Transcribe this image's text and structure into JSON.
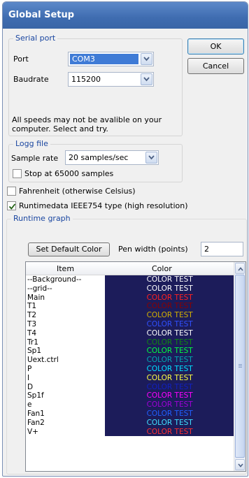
{
  "window": {
    "title": "Global Setup"
  },
  "serial_port": {
    "title": "Serial port",
    "port_label": "Port",
    "port_value": "COM3",
    "baudrate_label": "Baudrate",
    "baudrate_value": "115200",
    "note": "All speeds may not be avalible on your computer. Select and try."
  },
  "buttons": {
    "ok": "OK",
    "cancel": "Cancel"
  },
  "logg_file": {
    "title": "Logg file",
    "sample_rate_label": "Sample rate",
    "sample_rate_value": "20 samples/sec",
    "stop_label": "Stop at 65000 samples",
    "stop_checked": false
  },
  "options": {
    "fahrenheit_label": "Fahrenheit (otherwise Celsius)",
    "fahrenheit_checked": false,
    "runtime_label": "Runtimedata IEEE754 type (high resolution)",
    "runtime_checked": true
  },
  "runtime_graph": {
    "title": "Runtime graph",
    "set_default_label": "Set Default Color",
    "pen_width_label": "Pen width (points)",
    "pen_width_value": "2",
    "columns": [
      "Item",
      "Color"
    ],
    "rows": [
      {
        "item": "--Background--",
        "text": "COLOR TEST",
        "color": "#ffffff"
      },
      {
        "item": "--grid--",
        "text": "COLOR TEST",
        "color": "#ffffff"
      },
      {
        "item": "Main",
        "text": "COLOR TEST",
        "color": "#ff2020"
      },
      {
        "item": "T1",
        "text": "COLOR TEST",
        "color": "#8b0000"
      },
      {
        "item": "T2",
        "text": "COLOR TEST",
        "color": "#d4b000"
      },
      {
        "item": "T3",
        "text": "COLOR TEST",
        "color": "#3050ff"
      },
      {
        "item": "T4",
        "text": "COLOR TEST",
        "color": "#ffffff"
      },
      {
        "item": "Tr1",
        "text": "COLOR TEST",
        "color": "#108810"
      },
      {
        "item": "Sp1",
        "text": "COLOR TEST",
        "color": "#00ff40"
      },
      {
        "item": "Uext.ctrl",
        "text": "COLOR TEST",
        "color": "#00a8b0"
      },
      {
        "item": "P",
        "text": "COLOR TEST",
        "color": "#00e0ff"
      },
      {
        "item": "I",
        "text": "COLOR TEST",
        "color": "#ffff40"
      },
      {
        "item": "D",
        "text": "COLOR TEST",
        "color": "#1020c0"
      },
      {
        "item": "Sp1f",
        "text": "COLOR TEST",
        "color": "#ff00ff"
      },
      {
        "item": "e",
        "text": "COLOR TEST",
        "color": "#a000d8"
      },
      {
        "item": "Fan1",
        "text": "COLOR TEST",
        "color": "#2060ff"
      },
      {
        "item": "Fan2",
        "text": "COLOR TEST",
        "color": "#40e0ff"
      },
      {
        "item": "V+",
        "text": "COLOR TEST",
        "color": "#ff3030"
      }
    ]
  },
  "colors": {
    "title_bar": "#3f6cb0",
    "group_title": "#1a46a0",
    "color_cell_bg": "#1c1c5a"
  }
}
